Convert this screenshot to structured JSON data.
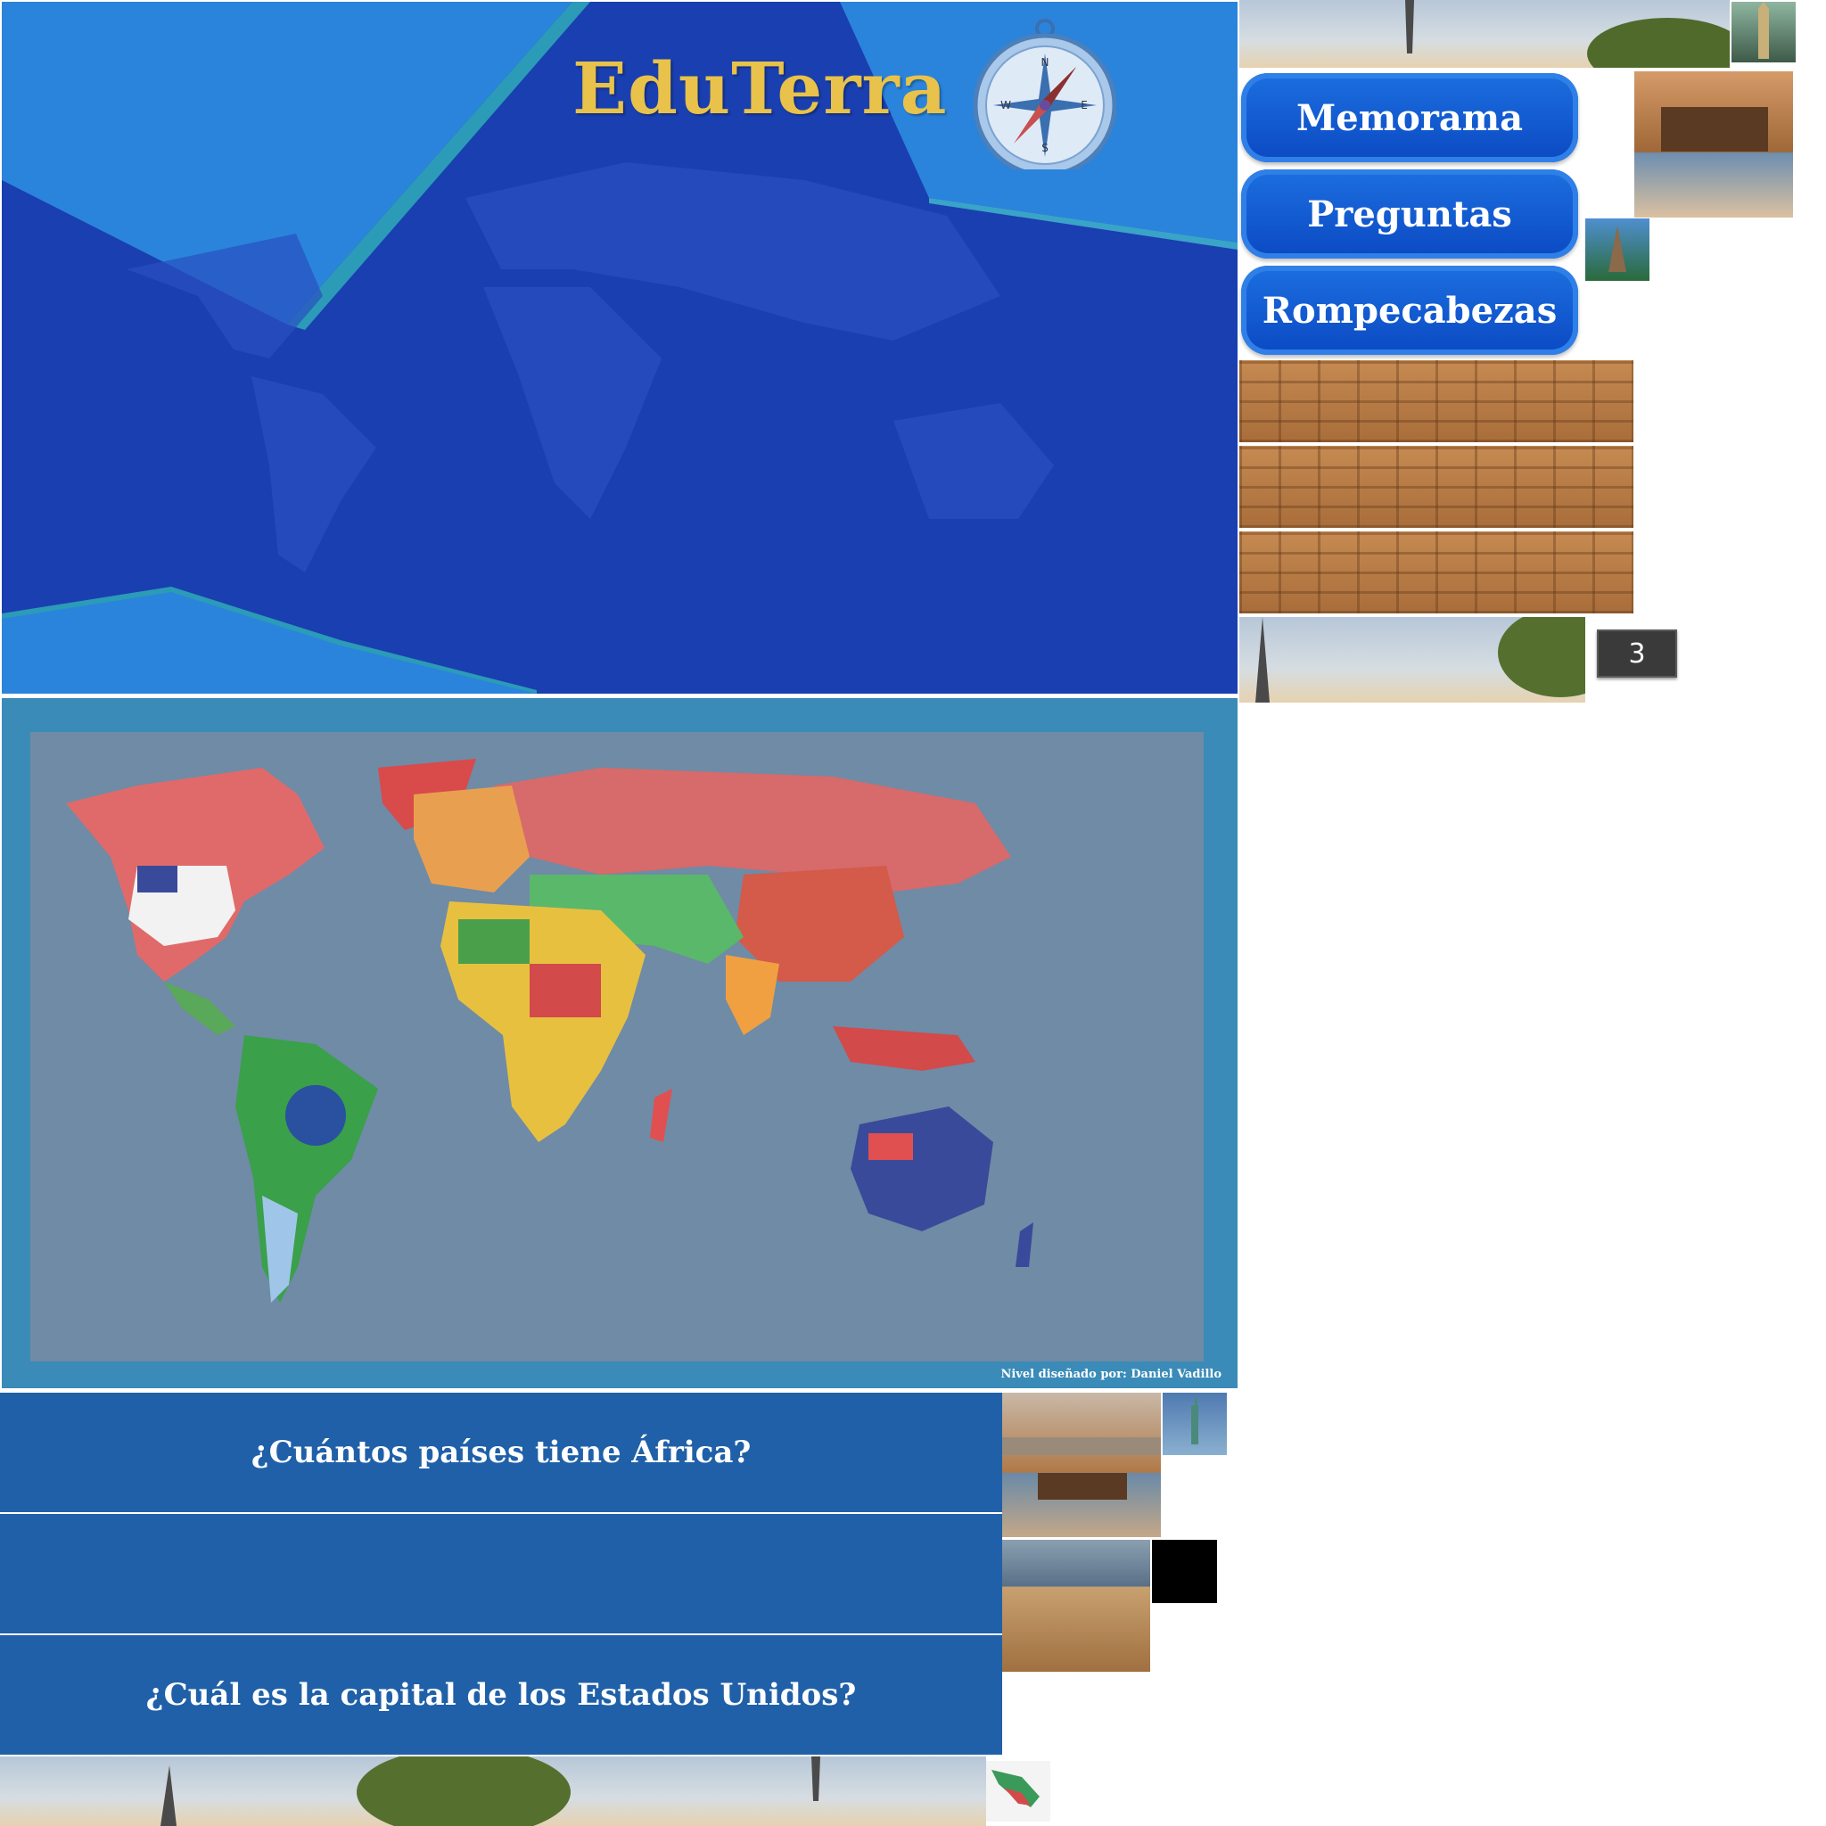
{
  "header": {
    "title": "EduTerra"
  },
  "menu": {
    "items": [
      {
        "label": "Memorama"
      },
      {
        "label": "Preguntas"
      },
      {
        "label": "Rompecabezas"
      }
    ]
  },
  "counter": {
    "value": "3"
  },
  "map": {
    "credit": "Nivel diseñado por: Daniel Vadillo"
  },
  "questions": [
    {
      "text": "¿Cuántos países tiene África?"
    },
    {
      "text": ""
    },
    {
      "text": "¿Cuál es la capital de los Estados Unidos?"
    }
  ],
  "colors": {
    "panel_blue": "#1a3fb0",
    "title_gold": "#e8c24a",
    "button_blue": "#0b49c2",
    "map_ocean": "#6f8ba6",
    "map_frame": "#3a8bb8",
    "question_bar": "#2060a8"
  },
  "icons": [
    "compass-icon",
    "world-flags-map"
  ]
}
